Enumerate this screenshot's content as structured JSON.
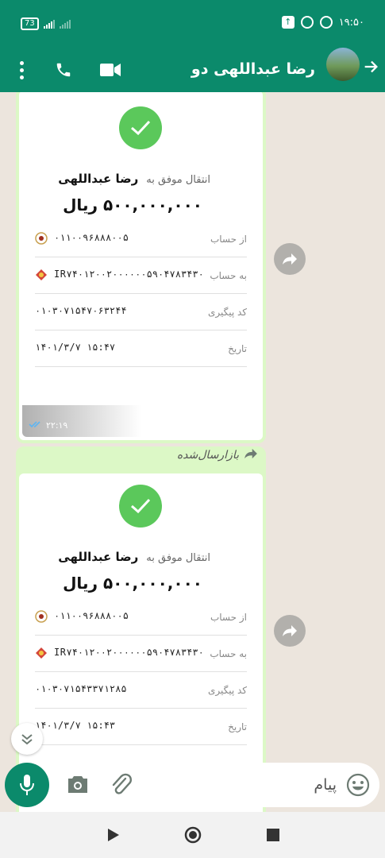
{
  "status_bar": {
    "battery": "73",
    "time": "۱۹:۵۰"
  },
  "header": {
    "contact_name": "رضا عبداللهی دو",
    "icons": [
      "more-vert-icon",
      "phone-icon",
      "video-call-icon",
      "avatar",
      "arrow-back-icon"
    ]
  },
  "messages": [
    {
      "forwarded_label": "",
      "receipt": {
        "transfer_prefix": "انتقال موفق به",
        "recipient": "رضا عبداللهی",
        "amount": "۵۰۰,۰۰۰,۰۰۰ ریال",
        "rows": [
          {
            "label": "از حساب",
            "value": "۰۱۱۰۰۹۶۸۸۸۰۰۵"
          },
          {
            "label": "به حساب",
            "value": "IR۷۴۰۱۲۰۰۲۰۰۰۰۰۰۵۹۰۴۷۸۳۴۳۰"
          },
          {
            "label": "کد پیگیری",
            "value": "۰۱۰۳۰۷۱۵۴۷۰۶۳۲۴۴"
          },
          {
            "label": "تاریخ",
            "value": "۱۴۰۱/۳/۷ ۱۵:۴۷"
          }
        ]
      },
      "time": "۲۲:۱۹"
    },
    {
      "forwarded_label": "بازارسال‌شده",
      "receipt": {
        "transfer_prefix": "انتقال موفق به",
        "recipient": "رضا عبداللهی",
        "amount": "۵۰۰,۰۰۰,۰۰۰ ریال",
        "rows": [
          {
            "label": "از حساب",
            "value": "۰۱۱۰۰۹۶۸۸۸۰۰۵"
          },
          {
            "label": "به حساب",
            "value": "IR۷۴۰۱۲۰۰۲۰۰۰۰۰۰۵۹۰۴۷۸۳۴۳۰"
          },
          {
            "label": "کد پیگیری",
            "value": "۰۱۰۳۰۷۱۵۴۳۳۷۱۲۸۵"
          },
          {
            "label": "تاریخ",
            "value": "۱۴۰۱/۳/۷ ۱۵:۴۳"
          }
        ]
      }
    }
  ],
  "composer": {
    "placeholder": "پیام"
  },
  "colors": {
    "header": "#0b8a6b",
    "bubble": "#dcf8c6",
    "chat_bg": "#ece5dd",
    "success": "#5bc85b"
  }
}
